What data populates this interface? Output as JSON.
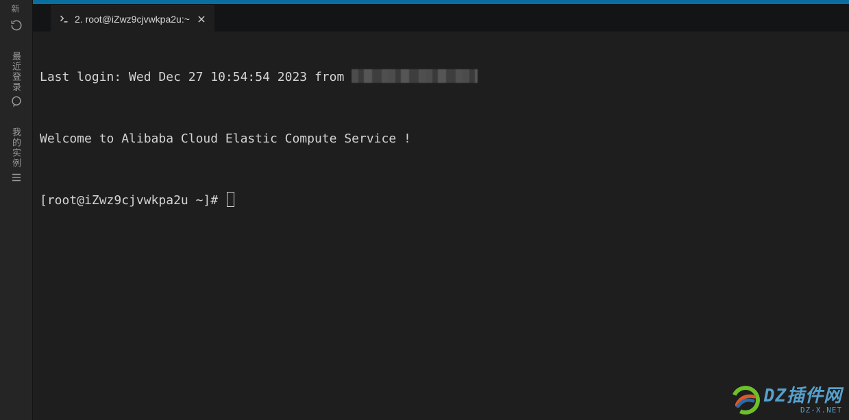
{
  "sidebar": {
    "top": {
      "label": "新"
    },
    "refresh": {
      "name": "refresh"
    },
    "recent_login": {
      "label": "最近登录"
    },
    "my_instances": {
      "label": "我的实例"
    }
  },
  "tab": {
    "label": "2. root@iZwz9cjvwkpa2u:~"
  },
  "terminal": {
    "last_login_prefix": "Last login: Wed Dec 27 10:54:54 2023 from ",
    "blank1": "",
    "welcome": "Welcome to Alibaba Cloud Elastic Compute Service !",
    "blank2": "",
    "prompt": "[root@iZwz9cjvwkpa2u ~]# "
  },
  "watermark": {
    "title": "DZ插件网",
    "sub": "DZ-X.NET"
  }
}
